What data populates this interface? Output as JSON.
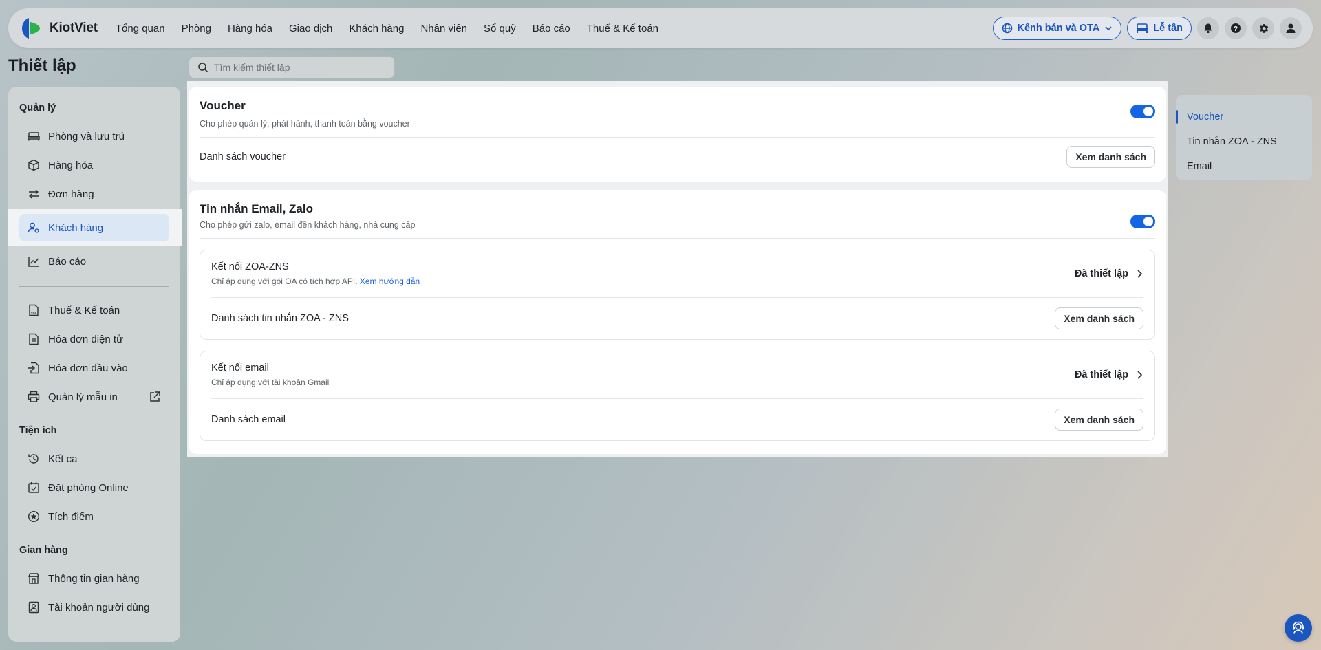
{
  "app": {
    "logo_text": "KiotViet",
    "accent_color": "#1a56c0",
    "toggle_color": "#1464e6"
  },
  "nav": {
    "items": [
      "Tổng quan",
      "Phòng",
      "Hàng hóa",
      "Giao dịch",
      "Khách hàng",
      "Nhân viên",
      "Sổ quỹ",
      "Báo cáo",
      "Thuế & Kế toán"
    ]
  },
  "header": {
    "channel_button": "Kênh bán và OTA",
    "reception_button": "Lễ tân",
    "icons": [
      "bell-icon",
      "help-icon",
      "gear-icon",
      "user-icon"
    ]
  },
  "page": {
    "title": "Thiết lập",
    "search_placeholder": "Tìm kiếm thiết lập"
  },
  "sidebar": {
    "sections": [
      {
        "title": "Quản lý",
        "items": [
          {
            "label": "Phòng và lưu trú",
            "icon": "bed-icon"
          },
          {
            "label": "Hàng hóa",
            "icon": "box-icon"
          },
          {
            "label": "Đơn hàng",
            "icon": "swap-icon"
          },
          {
            "label": "Khách hàng",
            "icon": "user-gear-icon",
            "active": true
          },
          {
            "label": "Báo cáo",
            "icon": "chart-icon"
          }
        ]
      },
      {
        "title": "",
        "items": [
          {
            "label": "Thuế & Kế toán",
            "icon": "vat-icon"
          },
          {
            "label": "Hóa đơn điện tử",
            "icon": "invoice-icon"
          },
          {
            "label": "Hóa đơn đầu vào",
            "icon": "invoice-in-icon"
          },
          {
            "label": "Quản lý mẫu in",
            "icon": "printer-icon",
            "external": true
          }
        ]
      },
      {
        "title": "Tiện ích",
        "items": [
          {
            "label": "Kết ca",
            "icon": "history-icon"
          },
          {
            "label": "Đặt phòng Online",
            "icon": "calendar-check-icon"
          },
          {
            "label": "Tích điểm",
            "icon": "star-circle-icon"
          }
        ]
      },
      {
        "title": "Gian hàng",
        "items": [
          {
            "label": "Thông tin gian hàng",
            "icon": "store-icon"
          },
          {
            "label": "Tài khoản người dùng",
            "icon": "id-card-icon"
          }
        ]
      }
    ]
  },
  "voucher": {
    "title": "Voucher",
    "description": "Cho phép quản lý, phát hành, thanh toán bằng voucher",
    "enabled": true,
    "list_label": "Danh sách voucher",
    "list_button": "Xem danh sách"
  },
  "messaging": {
    "title": "Tin nhắn Email, Zalo",
    "description": "Cho phép gửi zalo, email đến khách hàng, nhà cung cấp",
    "enabled": true,
    "zoa": {
      "title": "Kết nối ZOA-ZNS",
      "description": "Chỉ áp dụng với gói OA có tích hợp API.",
      "guide_link": "Xem hướng dẫn",
      "status": "Đã thiết lập",
      "list_label": "Danh sách tin nhắn ZOA - ZNS",
      "list_button": "Xem danh sách"
    },
    "email": {
      "title": "Kết nối email",
      "description": "Chỉ áp dụng với tài khoản Gmail",
      "status": "Đã thiết lập",
      "list_label": "Danh sách email",
      "list_button": "Xem danh sách"
    }
  },
  "toc": {
    "items": [
      "Voucher",
      "Tin nhắn ZOA - ZNS",
      "Email"
    ],
    "active_index": 0
  }
}
